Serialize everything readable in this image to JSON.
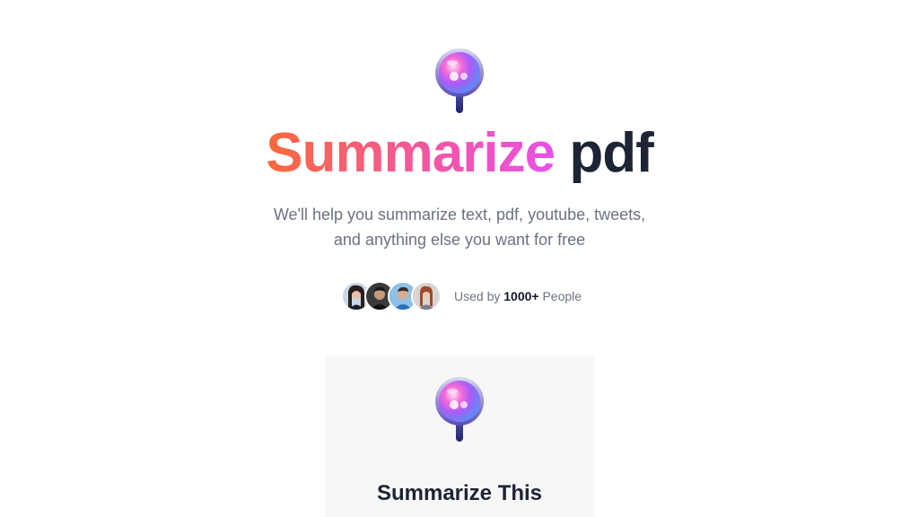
{
  "hero": {
    "title_highlight": "Summarize",
    "title_rest": "pdf",
    "subtitle_line1": "We'll help you summarize text, pdf, youtube, tweets,",
    "subtitle_line2": "and anything else you want for free",
    "logo_icon": "magnifier-orb-icon"
  },
  "social_proof": {
    "prefix": "Used by",
    "count": "1000+",
    "suffix": "People",
    "avatars": [
      "avatar-woman",
      "avatar-man-dark",
      "avatar-man-blue",
      "avatar-woman-red"
    ]
  },
  "card": {
    "title": "Summarize This",
    "logo_icon": "magnifier-orb-icon"
  },
  "colors": {
    "gradient_start": "#f96a3a",
    "gradient_mid": "#f556a0",
    "gradient_end": "#e850e8",
    "dark_text": "#1d2433",
    "muted_text": "#6b7280",
    "card_bg": "#f7f7f8"
  }
}
